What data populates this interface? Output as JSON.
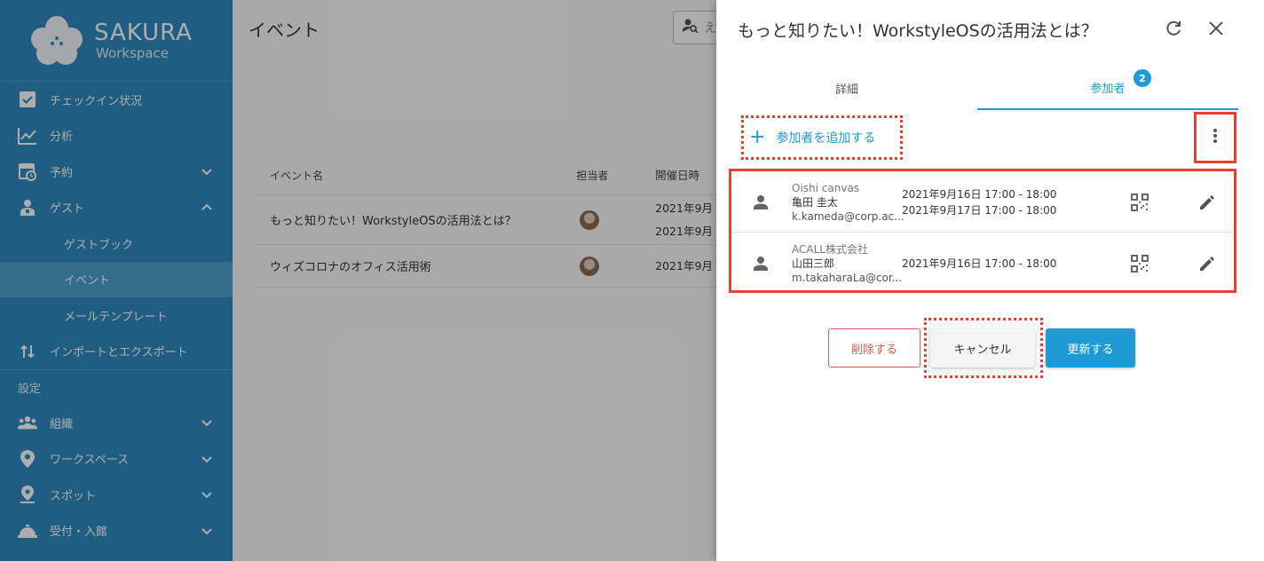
{
  "brand": {
    "name": "SAKURA",
    "subtitle": "Workspace"
  },
  "sidebar": {
    "items": [
      {
        "label": "チェックイン状況",
        "icon": "checkbox-icon"
      },
      {
        "label": "分析",
        "icon": "chart-line-icon"
      },
      {
        "label": "予約",
        "icon": "calendar-clock-icon",
        "expand": "chevron-down"
      },
      {
        "label": "ゲスト",
        "icon": "guest-icon",
        "expand": "chevron-up"
      },
      {
        "label": "ゲストブック"
      },
      {
        "label": "イベント",
        "active": true
      },
      {
        "label": "メールテンプレート"
      },
      {
        "label": "インポートとエクスポート",
        "icon": "import-export-icon"
      }
    ],
    "section_label": "設定",
    "settings_items": [
      {
        "label": "組織",
        "icon": "people-icon",
        "expand": "chevron-down"
      },
      {
        "label": "ワークスペース",
        "icon": "location-pin-icon",
        "expand": "chevron-down"
      },
      {
        "label": "スポット",
        "icon": "spot-pin-icon",
        "expand": "chevron-down"
      },
      {
        "label": "受付・入館",
        "icon": "reception-bell-icon",
        "expand": "chevron-down"
      }
    ]
  },
  "main": {
    "title": "イベント",
    "search_placeholder": "え",
    "table": {
      "headers": [
        "イベント名",
        "担当者",
        "開催日時"
      ],
      "rows": [
        {
          "name": "もっと知りたい！WorkstyleOSの活用法とは？",
          "dates": [
            "2021年9月",
            "2021年9月"
          ]
        },
        {
          "name": "ウィズコロナのオフィス活用術",
          "dates": [
            "2021年9月"
          ]
        }
      ]
    }
  },
  "dialog": {
    "title": "もっと知りたい！WorkstyleOSの活用法とは？",
    "tabs": [
      {
        "label": "詳細"
      },
      {
        "label": "参加者",
        "badge": "2",
        "active": true
      }
    ],
    "add_participant_label": "参加者を追加する",
    "participants": [
      {
        "org": "Oishi canvas",
        "name": "亀田 圭太",
        "email": "k.kameda@corp.ac...",
        "dates": [
          "2021年9月16日 17:00 - 18:00",
          "2021年9月17日 17:00 - 18:00"
        ]
      },
      {
        "org": "ACALL株式会社",
        "name": "山田三郎",
        "email": "m.takaharaLa@cor...",
        "dates": [
          "2021年9月16日 17:00 - 18:00"
        ]
      }
    ],
    "buttons": {
      "delete": "削除する",
      "cancel": "キャンセル",
      "update": "更新する"
    }
  },
  "colors": {
    "sidebar": "#2e8bc0",
    "accent": "#1e9ad6",
    "highlight": "#e8412e",
    "danger": "#e05a5a"
  }
}
